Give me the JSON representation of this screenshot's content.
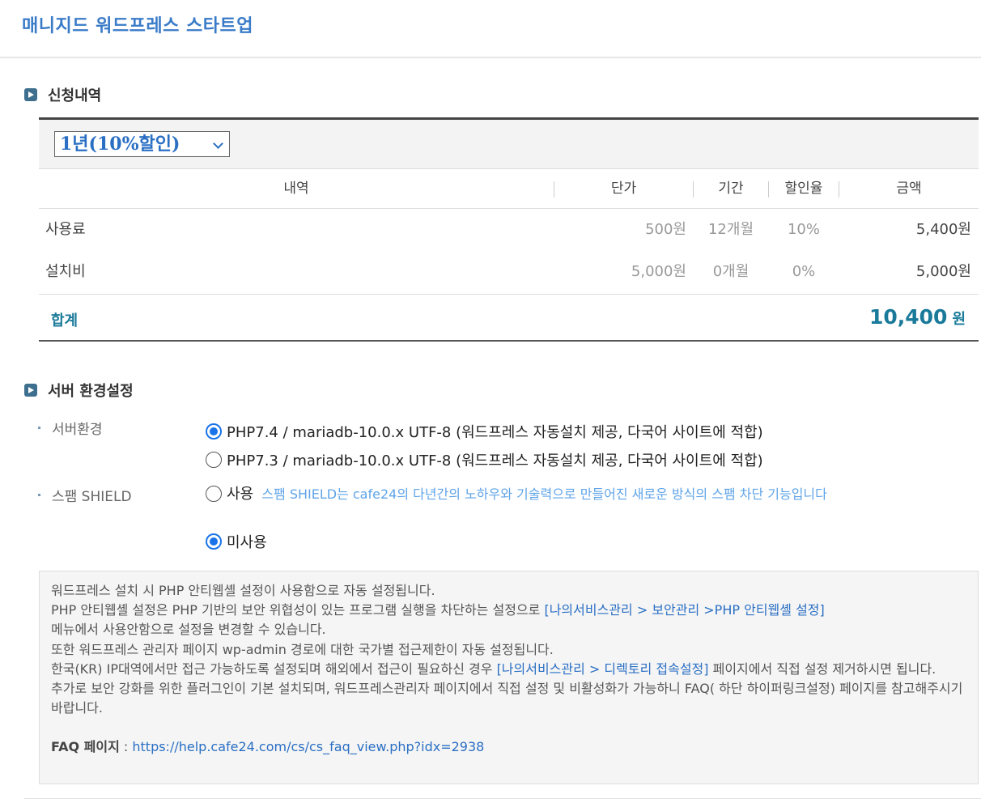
{
  "page_title": "매니지드 워드프레스 스타트업",
  "order": {
    "section_title": "신청내역",
    "period_select": "1년(10%할인)",
    "headers": {
      "item": "내역",
      "unit_price": "단가",
      "period": "기간",
      "discount": "할인율",
      "amount": "금액"
    },
    "rows": [
      {
        "name": "사용료",
        "unit_price": "500원",
        "period": "12개월",
        "discount": "10%",
        "amount": "5,400원"
      },
      {
        "name": "설치비",
        "unit_price": "5,000원",
        "period": "0개월",
        "discount": "0%",
        "amount": "5,000원"
      }
    ],
    "total_label": "합계",
    "total_amount": "10,400",
    "total_unit": "원"
  },
  "server": {
    "section_title": "서버 환경설정",
    "env_label": "서버환경",
    "env_options": [
      {
        "label": "PHP7.4 / mariadb-10.0.x UTF-8 (워드프레스 자동설치 제공, 다국어 사이트에 적합)",
        "checked": true
      },
      {
        "label": "PHP7.3 / mariadb-10.0.x UTF-8 (워드프레스 자동설치 제공, 다국어 사이트에 적합)",
        "checked": false
      }
    ],
    "spam_label": "스팸 SHIELD",
    "spam_use_label": "사용",
    "spam_desc": "스팸 SHIELD는 cafe24의 다년간의 노하우와 기술력으로 만들어진 새로운 방식의 스팸 차단 기능입니다",
    "spam_unused_label": "미사용",
    "spam_use_checked": false,
    "spam_unused_checked": true
  },
  "notice": {
    "line1": "워드프레스 설치 시 PHP 안티웹셸 설정이 사용함으로 자동 설정됩니다.",
    "line2a": "PHP 안티웹셸 설정은 PHP 기반의 보안 위협성이 있는 프로그램 실행을 차단하는 설정으로 ",
    "line2_link": "[나의서비스관리 > 보안관리 >PHP 안티웹셸 설정]",
    "line2b": "메뉴에서 사용안함으로 설정을 변경할 수 있습니다.",
    "line3": "또한 워드프레스 관리자 페이지 wp-admin 경로에 대한 국가별 접근제한이 자동 설정됩니다.",
    "line4a": "한국(KR) IP대역에서만 접근 가능하도록 설정되며 해외에서 접근이 필요하신 경우 ",
    "line4_link": "[나의서비스관리 > 디렉토리 접속설정]",
    "line4b": " 페이지에서 직접 설정 제거하시면 됩니다.",
    "line5": "추가로 보안 강화를 위한 플러그인이 기본 설치되며, 워드프레스관리자 페이지에서 직접 설정 및 비활성화가 가능하니 FAQ( 하단 하이퍼링크설정) 페이지를 참고해주시기 바랍니다.",
    "faq_label": "FAQ 페이지",
    "faq_sep": " : ",
    "faq_url": "https://help.cafe24.com/cs/cs_faq_view.php?idx=2938"
  }
}
